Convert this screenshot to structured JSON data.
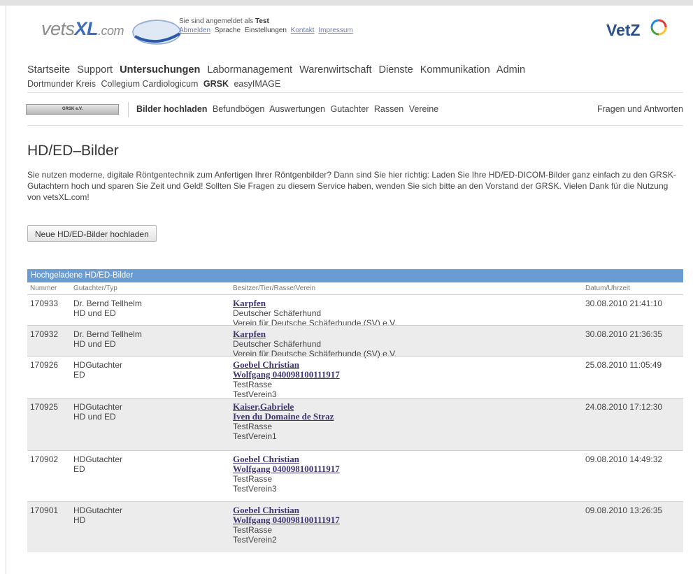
{
  "header": {
    "logo": {
      "brand_main": "vets",
      "brand_xl": "XL",
      "brand_tld": ".com"
    },
    "login": {
      "prefix": "Sie sind angemeldet als ",
      "user": "Test",
      "logout": "Abmelden",
      "language": "Sprache",
      "settings": "Einstellungen",
      "contact": "Kontakt",
      "imprint": "Impressum"
    },
    "partner_logo": "VetZ"
  },
  "main_nav": [
    "Startseite",
    "Support",
    "Untersuchungen",
    "Labormanagement",
    "Warenwirtschaft",
    "Dienste",
    "Kommunikation",
    "Admin"
  ],
  "main_nav_active": "Untersuchungen",
  "sub_nav": [
    "Dortmunder Kreis",
    "Collegium Cardiologicum",
    "GRSK",
    "easyIMAGE"
  ],
  "sub_nav_active": "GRSK",
  "third_nav": {
    "badge": "GRSK e.V.",
    "items": [
      "Bilder hochladen",
      "Befundbögen",
      "Auswertungen",
      "Gutachter",
      "Rassen",
      "Vereine"
    ],
    "active": "Bilder hochladen",
    "faq": "Fragen und Antworten"
  },
  "content": {
    "title": "HD/ED–Bilder",
    "intro": "Sie nutzen moderne, digitale Röntgentechnik zum Anfertigen Ihrer Röntgenbilder? Dann sind Sie hier richtig: Laden Sie Ihre HD/ED-DICOM-Bilder ganz einfach zu den GRSK-Gutachtern hoch und sparen Sie Zeit und Geld! Sollten Sie Fragen zu diesem Service haben, wenden Sie sich bitte an den Vorstand der GRSK. Vielen Dank für die Nutzung von vetsXL.com!",
    "upload_button": "Neue HD/ED-Bilder hochladen"
  },
  "table": {
    "title": "Hochgeladene HD/ED-Bilder",
    "columns": [
      "Nummer",
      "Gutachter/Typ",
      "Besitzer/Tier/Rasse/Verein",
      "Datum/Uhrzeit"
    ],
    "rows": [
      {
        "nummer": "170933",
        "gutachter": "Dr. Bernd Tellhelm",
        "typ": "HD und ED",
        "links": [
          "Karpfen"
        ],
        "details": [
          "Deutscher Schäferhund",
          "Verein für Deutsche Schäferhunde (SV) e.V."
        ],
        "datum": "30.08.2010 21:41:10"
      },
      {
        "nummer": "170932",
        "gutachter": "Dr. Bernd Tellhelm",
        "typ": "HD und ED",
        "links": [
          "Karpfen"
        ],
        "details": [
          "Deutscher Schäferhund",
          "Verein für Deutsche Schäferhunde (SV) e.V."
        ],
        "datum": "30.08.2010 21:36:35"
      },
      {
        "nummer": "170926",
        "gutachter": "HDGutachter",
        "typ": "ED",
        "links": [
          "Goebel Christian",
          "Wolfgang 040098100111917"
        ],
        "details": [
          "TestRasse",
          "TestVerein3"
        ],
        "datum": "25.08.2010 11:05:49"
      },
      {
        "nummer": "170925",
        "gutachter": "HDGutachter",
        "typ": "HD und ED",
        "links": [
          "Kaiser,Gabriele",
          "Iven du Domaine de Straz"
        ],
        "details": [
          "TestRasse",
          "TestVerein1"
        ],
        "datum": "24.08.2010 17:12:30"
      },
      {
        "nummer": "170902",
        "gutachter": "HDGutachter",
        "typ": "ED",
        "links": [
          "Goebel Christian",
          "Wolfgang 040098100111917"
        ],
        "details": [
          "TestRasse",
          "TestVerein3"
        ],
        "datum": "09.08.2010 14:49:32"
      },
      {
        "nummer": "170901",
        "gutachter": "HDGutachter",
        "typ": "HD",
        "links": [
          "Goebel Christian",
          "Wolfgang 040098100111917"
        ],
        "details": [
          "TestRasse",
          "TestVerein2"
        ],
        "datum": "09.08.2010 13:26:35"
      }
    ]
  }
}
